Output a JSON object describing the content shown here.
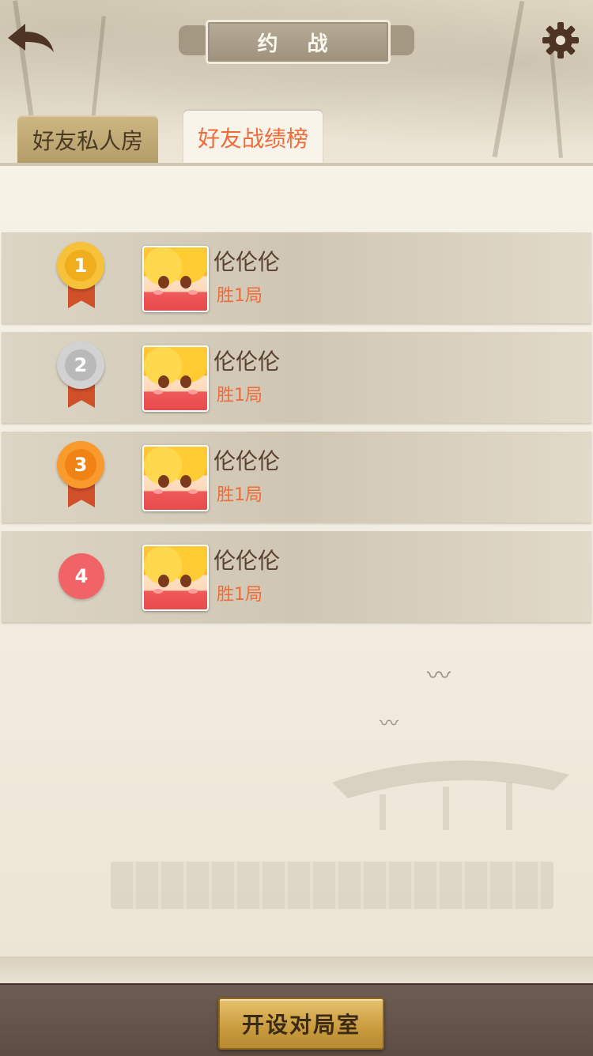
{
  "header": {
    "title": "约 战",
    "back_icon": "back-arrow-icon",
    "settings_icon": "gear-icon"
  },
  "tabs": [
    {
      "label": "好友私人房",
      "active": false
    },
    {
      "label": "好友战绩榜",
      "active": true
    }
  ],
  "ranking": [
    {
      "rank": "1",
      "medal": "gold",
      "name": "伦伦伦",
      "wins": "胜1局"
    },
    {
      "rank": "2",
      "medal": "silver",
      "name": "伦伦伦",
      "wins": "胜1局"
    },
    {
      "rank": "3",
      "medal": "bronze",
      "name": "伦伦伦",
      "wins": "胜1局"
    },
    {
      "rank": "4",
      "medal": "none",
      "name": "伦伦伦",
      "wins": "胜1局"
    }
  ],
  "footer": {
    "create_room_label": "开设对局室"
  },
  "colors": {
    "accent": "#ef6b3a",
    "gold": "#f7c13a",
    "silver": "#c8c8c8",
    "bronze": "#fb9a2c",
    "fourth": "#f06468"
  }
}
